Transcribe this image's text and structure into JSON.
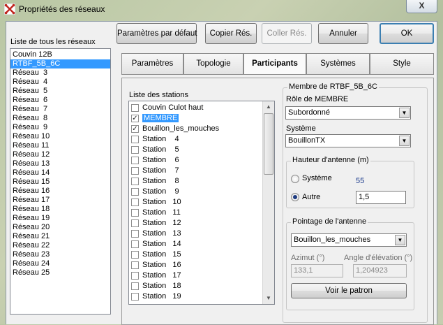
{
  "window": {
    "title": "Propriétés des réseaux",
    "close_label": "X"
  },
  "toolbar": {
    "defaults_label": "Paramètres par défaut",
    "copy_label": "Copier Rés.",
    "paste_label": "Coller Rés.",
    "cancel_label": "Annuler",
    "ok_label": "OK"
  },
  "networks": {
    "label": "Liste de tous les réseaux",
    "items": [
      "Couvin 12B",
      "RTBF_5B_6C",
      "Réseau  3",
      "Réseau  4",
      "Réseau  5",
      "Réseau  6",
      "Réseau  7",
      "Réseau  8",
      "Réseau  9",
      "Réseau 10",
      "Réseau 11",
      "Réseau 12",
      "Réseau 13",
      "Réseau 14",
      "Réseau 15",
      "Réseau 16",
      "Réseau 17",
      "Réseau 18",
      "Réseau 19",
      "Réseau 20",
      "Réseau 21",
      "Réseau 22",
      "Réseau 23",
      "Réseau 24",
      "Réseau 25"
    ],
    "selected": "RTBF_5B_6C"
  },
  "tabs": [
    {
      "label": "Paramètres"
    },
    {
      "label": "Topologie"
    },
    {
      "label": "Participants",
      "active": true
    },
    {
      "label": "Systèmes"
    },
    {
      "label": "Style"
    }
  ],
  "stations": {
    "label": "Liste des stations",
    "items": [
      {
        "name": "Couvin Culot haut",
        "checked": false
      },
      {
        "name": "MEMBRE",
        "checked": true,
        "selected": true
      },
      {
        "name": "Bouillon_les_mouches",
        "checked": true
      },
      {
        "name": "Station    4",
        "checked": false
      },
      {
        "name": "Station    5",
        "checked": false
      },
      {
        "name": "Station    6",
        "checked": false
      },
      {
        "name": "Station    7",
        "checked": false
      },
      {
        "name": "Station    8",
        "checked": false
      },
      {
        "name": "Station    9",
        "checked": false
      },
      {
        "name": "Station   10",
        "checked": false
      },
      {
        "name": "Station   11",
        "checked": false
      },
      {
        "name": "Station   12",
        "checked": false
      },
      {
        "name": "Station   13",
        "checked": false
      },
      {
        "name": "Station   14",
        "checked": false
      },
      {
        "name": "Station   15",
        "checked": false
      },
      {
        "name": "Station   16",
        "checked": false
      },
      {
        "name": "Station   17",
        "checked": false
      },
      {
        "name": "Station   18",
        "checked": false
      },
      {
        "name": "Station   19",
        "checked": false
      }
    ]
  },
  "member": {
    "group_title": "Membre de RTBF_5B_6C",
    "role_label": "Rôle de MEMBRE",
    "role_value": "Subordonné",
    "system_label": "Système",
    "system_value": "BouillonTX"
  },
  "antenna_height": {
    "group_title": "Hauteur d'antenne (m)",
    "system_option": "Système",
    "system_value": "55",
    "other_option": "Autre",
    "other_value": "1,5",
    "selected": "Autre"
  },
  "pointing": {
    "group_title": "Pointage de l'antenne",
    "target_value": "Bouillon_les_mouches",
    "azimuth_label": "Azimut (°)",
    "azimuth_value": "133,1",
    "elevation_label": "Angle d'élévation (°)",
    "elevation_value": "1,204923",
    "pattern_button": "Voir le patron"
  },
  "colors": {
    "selection": "#3399ff",
    "value_blue": "#1a3a8c"
  }
}
